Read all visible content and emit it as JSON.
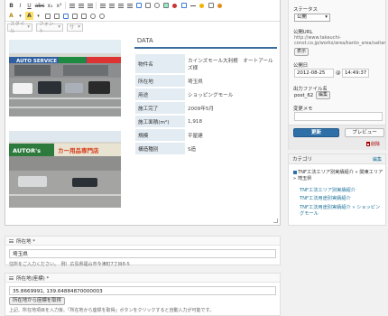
{
  "toolbar": {
    "row1": [
      "B",
      "I",
      "U",
      "abc",
      "x₂",
      "x²"
    ],
    "row2_selects": {
      "style": "スタイル",
      "font": "フォント",
      "size": "サ"
    }
  },
  "content": {
    "data_title": "DATA",
    "rows": [
      {
        "key": "物件名",
        "value": "カインズモール大利根　オートアールズ様"
      },
      {
        "key": "所在地",
        "value": "埼玉県"
      },
      {
        "key": "用途",
        "value": "ショッピングモール"
      },
      {
        "key": "施工完了",
        "value": "2009年5月"
      },
      {
        "key": "施工面積(m²)",
        "value": "1,918"
      },
      {
        "key": "規模",
        "value": "平屋建"
      },
      {
        "key": "構造種別",
        "value": "S造"
      }
    ],
    "photo1_sign": "AUTO SERVICE",
    "photo2_sign": "AUTOR's",
    "photo2_sign_extra": "カー用品専門店"
  },
  "fields": {
    "location": {
      "label": "所在地 *",
      "value": "埼玉県",
      "note": "住所をご入力ください。　例）広島県福山市今津町7丁目8-5"
    },
    "latlng": {
      "label": "所在地(座標) *",
      "value": "35.8669991, 139.64884870000003",
      "button": "所在地から座標を取得",
      "note": "上記、所在地項目を入力後、「所在地から座標を取得」ボタンをクリックすると自動入力が可能です。"
    }
  },
  "sidebar": {
    "status_label": "ステータス",
    "status_value": "公開",
    "url_label": "公開URL",
    "url_lines": [
      "http://www.takeuchi-",
      "const.co.jp/works/area/kanto_area/saitar"
    ],
    "url_button": "表示",
    "date_label": "公開日",
    "date_value": "2012-08-25",
    "time_value": "14:49:37",
    "filename_label": "出力ファイル名",
    "filename_value": "post_62",
    "filename_button": "編集",
    "memo_label": "変更メモ",
    "update_button": "更新",
    "preview_button": "プレビュー",
    "trash_link": "削除",
    "category_title": "カテゴリ",
    "category_edit": "編集",
    "categories": [
      {
        "label": "TNF工法エリア別実績紹介 » 関東エリア » 埼玉県",
        "checked": true
      },
      {
        "label": "TNF工法エリア別実績紹介",
        "checked": false
      },
      {
        "label": "TNF工法用途別実績紹介",
        "checked": false
      },
      {
        "label": "TNF工法用途別実績紹介 » ショッピングモール",
        "checked": false
      }
    ]
  },
  "colors": {
    "accent": "#2e6fa8",
    "table_key_bg": "#e3ecf3",
    "link": "#21759b"
  }
}
